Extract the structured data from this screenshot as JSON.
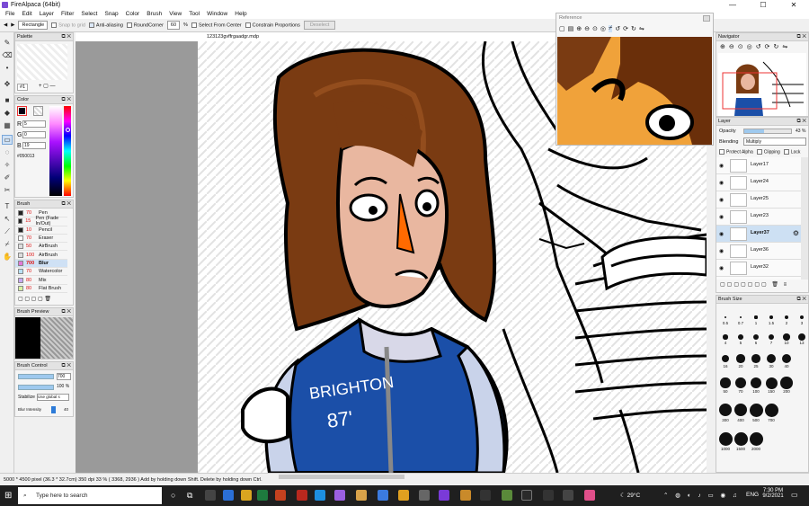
{
  "app": {
    "title": "FireAlpaca (64bit)",
    "min": "—",
    "max": "☐",
    "close": "✕"
  },
  "menu": [
    "File",
    "Edit",
    "Layer",
    "Filter",
    "Select",
    "Snap",
    "Color",
    "Brush",
    "View",
    "Tool",
    "Window",
    "Help"
  ],
  "toolbar": {
    "shape": "Rectangle",
    "snap_to_grid": "Snap to grid",
    "anti_aliasing": "Anti-aliasing",
    "round_corner": "RoundCorner",
    "round_value": "60",
    "percent": "%",
    "select_from_center": "Select From Center",
    "constrain": "Constrain Proportions",
    "deselect": "Deselect"
  },
  "file_tab": "123123gvffrgaadgr.mdp",
  "palette": {
    "title": "Palette",
    "index": "#1"
  },
  "color": {
    "title": "Color",
    "r_label": "R",
    "g_label": "G",
    "b_label": "B",
    "r": "5",
    "g": "0",
    "b": "19",
    "hex": "#050013",
    "current": "#050013"
  },
  "brush": {
    "title": "Brush",
    "items": [
      {
        "size": "70",
        "name": "Pen",
        "color": "#222222"
      },
      {
        "size": "15",
        "name": "Pen (Fade In/Out)",
        "color": "#222222"
      },
      {
        "size": "10",
        "name": "Pencil",
        "color": "#222222"
      },
      {
        "size": "70",
        "name": "Eraser",
        "color": "#ffffff"
      },
      {
        "size": "50",
        "name": "AirBrush",
        "color": "#dddddd"
      },
      {
        "size": "100",
        "name": "AirBrush",
        "color": "#dddddd"
      },
      {
        "size": "700",
        "name": "Blur",
        "color": "#e07ad8"
      },
      {
        "size": "70",
        "name": "Watercolor",
        "color": "#b8e0f5"
      },
      {
        "size": "80",
        "name": "Mix",
        "color": "#c7a8f0"
      },
      {
        "size": "80",
        "name": "Flat Brush",
        "color": "#d7f0a0"
      }
    ]
  },
  "brush_preview": {
    "title": "Brush Preview"
  },
  "brush_control": {
    "title": "Brush Control",
    "size": "700",
    "opacity": "100",
    "opacity_unit": "%",
    "stabilize_label": "Stabilize",
    "stabilize_value": "Use global s",
    "blur_label": "Blur Intensity",
    "blur_value": "40"
  },
  "reference": {
    "title": "Reference"
  },
  "navigator": {
    "title": "Navigator"
  },
  "layer": {
    "title": "Layer",
    "opacity_label": "Opacity",
    "opacity_value": "43",
    "opacity_unit": "%",
    "blending_label": "Blending",
    "blending_value": "Multiply",
    "protect_alpha": "Protect Alpha",
    "clipping": "Clipping",
    "lock": "Lock",
    "rows": [
      {
        "name": "Layer17",
        "selected": false
      },
      {
        "name": "Layer24",
        "selected": false
      },
      {
        "name": "Layer25",
        "selected": false
      },
      {
        "name": "Layer23",
        "selected": false
      },
      {
        "name": "Layer37",
        "selected": true
      },
      {
        "name": "Layer36",
        "selected": false
      },
      {
        "name": "Layer32",
        "selected": false
      }
    ]
  },
  "brush_size": {
    "title": "Brush Size",
    "sizes": [
      "0.5",
      "0.7",
      "1",
      "1.5",
      "2",
      "3",
      "4",
      "5",
      "6",
      "7",
      "10",
      "13",
      "16",
      "20",
      "25",
      "30",
      "40",
      "50",
      "70",
      "100",
      "150",
      "200",
      "300",
      "400",
      "500",
      "700",
      "1000",
      "1500",
      "2000"
    ]
  },
  "status": "5000 * 4500 pixel  (36.3 * 32.7cm)  350 dpi  33 %  ( 3368, 2936 )  Add by holding down Shift. Delete by holding down Ctrl.",
  "drawing": {
    "jacket_text_1": "BRIGHTON",
    "jacket_text_2": "87'"
  },
  "taskbar": {
    "search_placeholder": "Type here to search",
    "weather": "29°C",
    "lang": "ENG",
    "time": "7:30 PM",
    "date": "9/2/2021"
  }
}
